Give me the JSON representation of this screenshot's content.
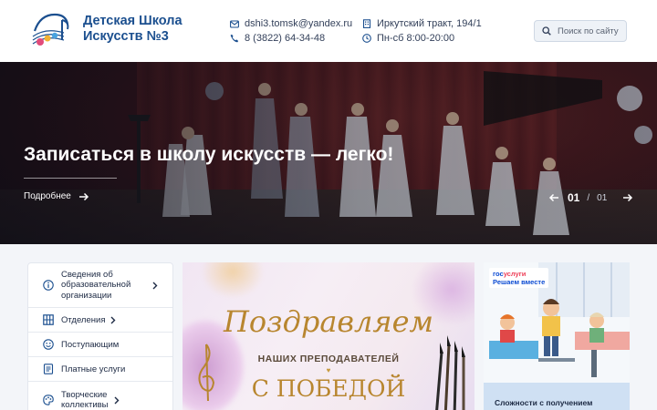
{
  "header": {
    "school_name_line1": "Детская Школа",
    "school_name_line2": "Искусств №3",
    "email": "dshi3.tomsk@yandex.ru",
    "phone": "8 (3822) 64-34-48",
    "address": "Иркутский тракт, 194/1",
    "hours": "Пн-сб 8:00-20:00",
    "search_placeholder": "Поиск по сайту"
  },
  "hero": {
    "title": "Записаться в школу искусств — легко!",
    "more_label": "Подробнее",
    "slide_current": "01",
    "slide_separator": "/",
    "slide_total": "01"
  },
  "menu": {
    "items": [
      {
        "label_lines": [
          "Сведения об",
          "образовательной",
          "организации"
        ],
        "icon": "info-icon"
      },
      {
        "label": "Отделения",
        "icon": "grid-icon"
      },
      {
        "label": "Поступающим",
        "icon": "smile-icon"
      },
      {
        "label": "Платные услуги",
        "icon": "document-icon"
      },
      {
        "label_lines": [
          "Творческие",
          "коллективы"
        ],
        "icon": "palette-icon"
      }
    ]
  },
  "banner": {
    "script_title": "Поздравляем",
    "subtitle": "НАШИХ ПРЕПОДАВАТЕЛЕЙ",
    "big_text": "С ПОБЕДОЙ"
  },
  "gosuslugi": {
    "logo_part1": "гос",
    "logo_part2": "услуги",
    "logo_tagline": "Решаем вместе",
    "caption": "Сложности с получением"
  },
  "colors": {
    "brand_blue": "#1b4f8f",
    "gold": "#b8862f",
    "gos_blue": "#0d4cd3",
    "gos_red": "#ee3f58"
  }
}
